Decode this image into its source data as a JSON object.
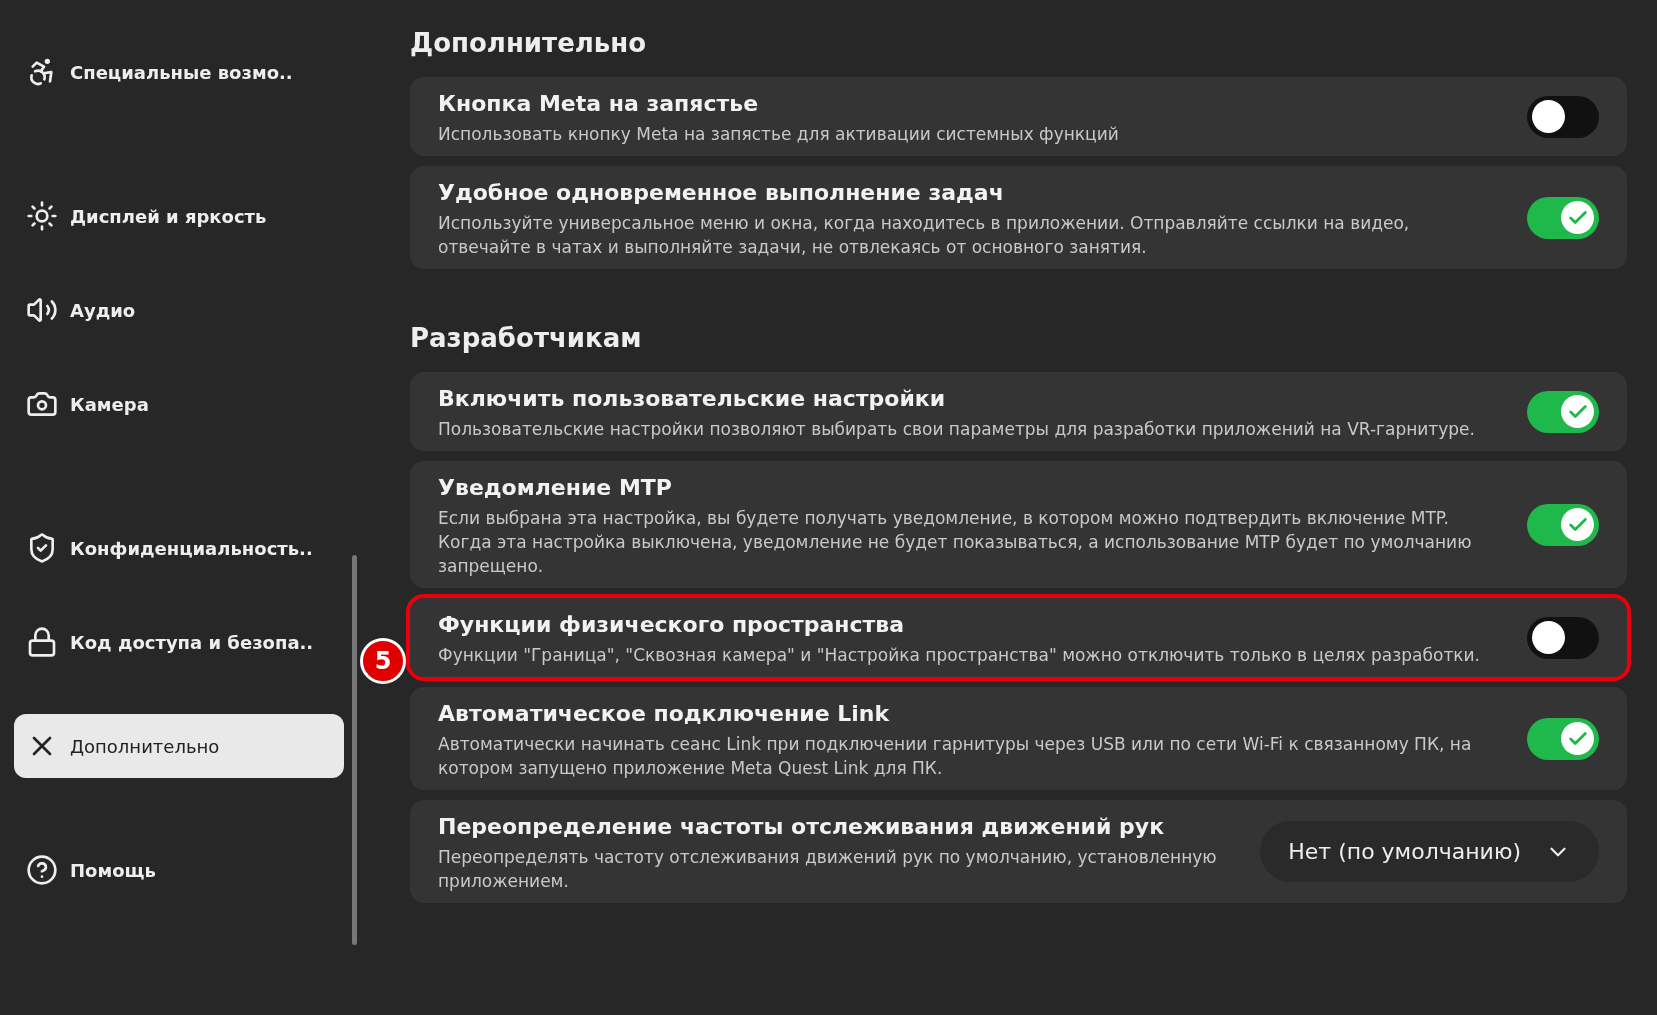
{
  "sidebar": {
    "items": [
      {
        "kind": "accessibility",
        "label": "Специальные возмо..",
        "selected": false
      },
      {
        "kind": "sun",
        "label": "Дисплей и яркость",
        "selected": false
      },
      {
        "kind": "speaker",
        "label": "Аудио",
        "selected": false
      },
      {
        "kind": "camera",
        "label": "Камера",
        "selected": false
      },
      {
        "kind": "shield",
        "label": "Конфиденциальность..",
        "selected": false
      },
      {
        "kind": "lock",
        "label": "Код доступа и безопа..",
        "selected": false
      },
      {
        "kind": "cross",
        "label": "Дополнительно",
        "selected": true
      },
      {
        "kind": "help",
        "label": "Помощь",
        "selected": false
      }
    ]
  },
  "sections": [
    {
      "title": "Дополнительно",
      "rows": [
        {
          "kind": "toggle",
          "title": "Кнопка Meta на запястье",
          "description": "Использовать кнопку Meta на запястье для активации системных функций",
          "on": false,
          "highlighted": false
        },
        {
          "kind": "toggle",
          "title": "Удобное одновременное выполнение задач",
          "description": "Используйте универсальное меню и окна, когда находитесь в приложении. Отправляйте ссылки на видео, отвечайте в чатах и выполняйте задачи, не отвлекаясь от основного занятия.",
          "on": true,
          "highlighted": false
        }
      ]
    },
    {
      "title": "Разработчикам",
      "rows": [
        {
          "kind": "toggle",
          "title": "Включить пользовательские настройки",
          "description": "Пользовательские настройки позволяют выбирать свои параметры для разработки приложений на VR-гарнитуре.",
          "on": true,
          "highlighted": false
        },
        {
          "kind": "toggle",
          "title": "Уведомление MTP",
          "description": "Если выбрана эта настройка, вы будете получать уведомление, в котором можно подтвердить включение MTP. Когда эта настройка выключена, уведомление не будет показываться, а использование MTP будет по умолчанию запрещено.",
          "on": true,
          "highlighted": false
        },
        {
          "kind": "toggle",
          "title": "Функции физического пространства",
          "description": "Функции \"Граница\", \"Сквозная камера\" и \"Настройка пространства\" можно отключить только в целях разработки.",
          "on": false,
          "highlighted": true,
          "annotation": "5"
        },
        {
          "kind": "toggle",
          "title": "Автоматическое подключение Link",
          "description": "Автоматически начинать сеанс Link при подключении гарнитуры через USB или по сети Wi-Fi к связанному ПК, на котором запущено приложение Meta Quest Link для ПК.",
          "on": true,
          "highlighted": false
        },
        {
          "kind": "dropdown",
          "title": "Переопределение частоты отслеживания движений рук",
          "description": "Переопределять частоту отслеживания движений рук по умолчанию, установленную приложением.",
          "value": "Нет (по умолчанию)",
          "highlighted": false
        }
      ]
    }
  ]
}
